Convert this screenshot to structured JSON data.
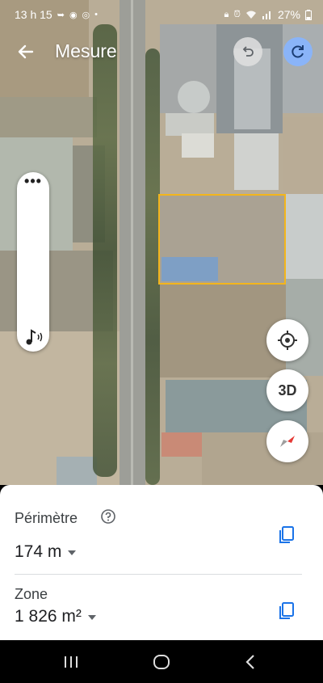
{
  "status_bar": {
    "time": "13 h 15",
    "battery": "27%"
  },
  "app_bar": {
    "title": "Mesure"
  },
  "map": {
    "buttons": {
      "view_3d_label": "3D"
    },
    "measure_color": "#f3b51c"
  },
  "measurements": {
    "perimeter": {
      "label": "Périmètre",
      "value": "174 m"
    },
    "area": {
      "label": "Zone",
      "value": "1 826 m²"
    }
  },
  "colors": {
    "accent": "#1a73e8",
    "redo_button": "#8ab4f8"
  },
  "icons": {
    "back": "arrow-back-icon",
    "undo": "undo-icon",
    "redo": "redo-icon",
    "more": "more-horizontal-icon",
    "audio": "music-note-icon",
    "locate": "my-location-icon",
    "compass": "compass-icon",
    "help": "help-circle-icon",
    "copy": "copy-icon"
  }
}
